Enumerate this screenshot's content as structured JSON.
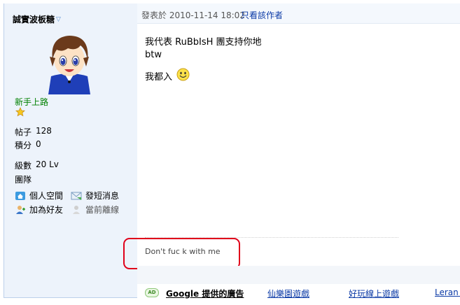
{
  "sidebar": {
    "username": "誠實波板糖",
    "rank": "新手上路",
    "stats": [
      {
        "label": "帖子",
        "value": "128"
      },
      {
        "label": "積分",
        "value": "0"
      },
      {
        "label": "級數",
        "value": "20 Lv"
      },
      {
        "label": "團隊",
        "value": ""
      }
    ],
    "links": [
      {
        "label": "個人空間",
        "icon": "home-icon"
      },
      {
        "label": "發短消息",
        "icon": "message-icon"
      },
      {
        "label": "加為好友",
        "icon": "add-friend-icon"
      },
      {
        "label": "當前離線",
        "icon": "offline-user-icon"
      }
    ]
  },
  "post": {
    "time": "發表於 2010-11-14 18:02",
    "only_author": "只看該作者",
    "lines": [
      "我代表 RuBbIsH 團支持你地",
      "btw",
      "我都入"
    ],
    "emoticon": "smiley-icon"
  },
  "signature": "Don't fuc k with me",
  "ads": {
    "badge": "AD",
    "title": "Google 提供的廣告",
    "links": [
      "仙樂園遊戲",
      "好玩線上遊戲",
      "Leran E"
    ]
  },
  "colors": {
    "sidebar_bg": "#edf3fb",
    "header_bg": "#f4f8fd",
    "rank_green": "#008000",
    "link_blue": "#0b3aa6",
    "highlight_red": "#e0001a"
  }
}
